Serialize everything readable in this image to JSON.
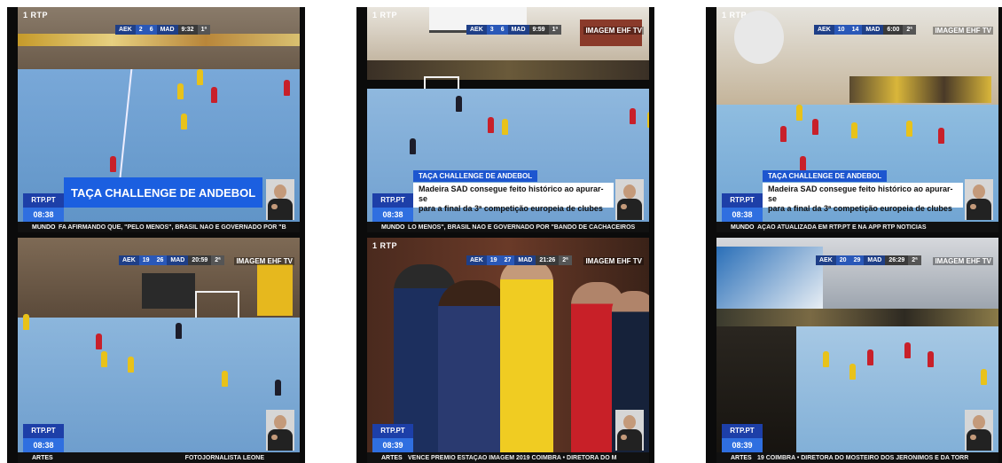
{
  "panels": [
    {
      "top": {
        "scoreboard": {
          "team_a": "AEK",
          "score_a": "2",
          "score_b": "6",
          "team_b": "MAD",
          "clock": "9:32",
          "half": "1ª"
        },
        "show_ehf": false,
        "title_card": "TAÇA CHALLENGE DE ANDEBOL",
        "brand": {
          "site": "RTP.PT",
          "time": "08:38"
        },
        "ticker": {
          "category": "MUNDO",
          "text": "FA AFIRMANDO QUE, \"PELO MENOS\", BRASIL NÃO É GOVERNADO POR \"B"
        }
      },
      "bottom": {
        "scoreboard": {
          "team_a": "AEK",
          "score_a": "19",
          "score_b": "26",
          "team_b": "MAD",
          "clock": "20:59",
          "half": "2ª"
        },
        "show_ehf": true,
        "ehf": "IMAGEM EHF TV",
        "brand": {
          "site": "RTP.PT",
          "time": "08:38"
        },
        "ticker": {
          "category": "ARTES",
          "text": "FOTOJORNALISTA LEONE"
        }
      }
    },
    {
      "top": {
        "scoreboard": {
          "team_a": "AEK",
          "score_a": "3",
          "score_b": "6",
          "team_b": "MAD",
          "clock": "9:59",
          "half": "1ª"
        },
        "ehf": "IMAGEM EHF TV",
        "headline": {
          "tag": "TAÇA CHALLENGE DE ANDEBOL",
          "line1": "Madeira SAD consegue feito histórico ao apurar-se",
          "line2": "para a final da 3ª competição europeia de clubes"
        },
        "brand": {
          "site": "RTP.PT",
          "time": "08:38"
        },
        "ticker": {
          "category": "MUNDO",
          "text": "LO MENOS\", BRASIL NÃO É GOVERNADO POR \"BANDO DE CACHACEIROS"
        }
      },
      "bottom": {
        "scoreboard": {
          "team_a": "AEK",
          "score_a": "19",
          "score_b": "27",
          "team_b": "MAD",
          "clock": "21:26",
          "half": "2ª"
        },
        "ehf": "IMAGEM EHF TV",
        "brand": {
          "site": "RTP.PT",
          "time": "08:39"
        },
        "ticker": {
          "category": "ARTES",
          "text": "VENCE PRÉMIO ESTAÇÃO IMAGEM 2019 COIMBRA  •  DIRETORA DO M"
        }
      }
    },
    {
      "top": {
        "scoreboard": {
          "team_a": "AEK",
          "score_a": "10",
          "score_b": "14",
          "team_b": "MAD",
          "clock": "6:00",
          "half": "2ª"
        },
        "ehf": "IMAGEM EHF TV",
        "headline": {
          "tag": "TAÇA CHALLENGE DE ANDEBOL",
          "line1": "Madeira SAD consegue feito histórico ao apurar-se",
          "line2": "para a final da 3ª competição europeia de clubes"
        },
        "brand": {
          "site": "RTP.PT",
          "time": "08:38"
        },
        "ticker": {
          "category": "MUNDO",
          "text": "AÇÃO ATUALIZADA EM RTP.PT E NA APP RTP NOTÍCIAS"
        }
      },
      "bottom": {
        "scoreboard": {
          "team_a": "AEK",
          "score_a": "20",
          "score_b": "29",
          "team_b": "MAD",
          "clock": "26:29",
          "half": "2ª"
        },
        "ehf": "IMAGEM EHF TV",
        "brand": {
          "site": "RTP.PT",
          "time": "08:39"
        },
        "ticker": {
          "category": "ARTES",
          "text": "19 COIMBRA  •  DIRETORA DO MOSTEIRO DOS JERÓNIMOS E DA TORR"
        }
      }
    }
  ],
  "channel_logo": "1 RTP",
  "colors": {
    "brand_blue": "#1d3fa8",
    "time_blue": "#2f6fe0",
    "court_blue": "#5f9bd0",
    "team_red": "#c8202a",
    "team_yellow": "#e8c21a"
  }
}
